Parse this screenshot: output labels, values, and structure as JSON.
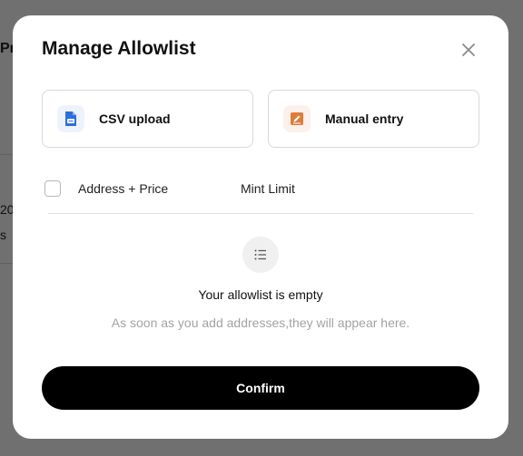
{
  "background": {
    "fragments": [
      "Pr",
      "20",
      "s"
    ]
  },
  "modal": {
    "title": "Manage Allowlist",
    "options": [
      {
        "label": "CSV upload",
        "icon": "csv-file-icon",
        "color": "#2f6fdb"
      },
      {
        "label": "Manual entry",
        "icon": "edit-note-icon",
        "color": "#e07b3a"
      }
    ],
    "table": {
      "columns": [
        "Address + Price",
        "Mint Limit"
      ],
      "rows": []
    },
    "empty_state": {
      "icon": "list-icon",
      "title": "Your allowlist is empty",
      "subtitle": "As soon as you add addresses,they will appear here."
    },
    "confirm_label": "Confirm"
  }
}
